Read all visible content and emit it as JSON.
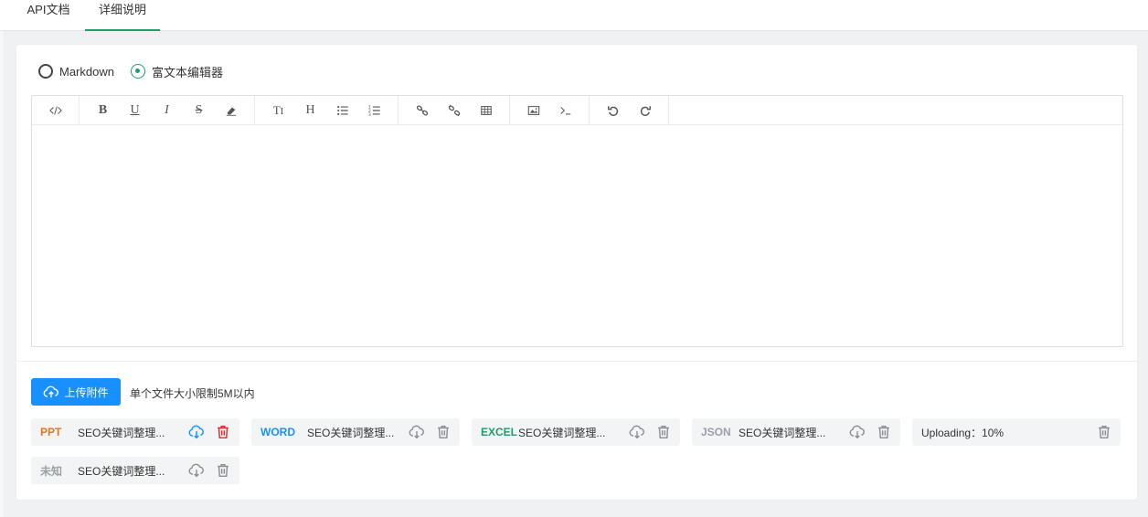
{
  "tabs": [
    {
      "label": "API文档",
      "active": false
    },
    {
      "label": "详细说明",
      "active": true
    }
  ],
  "editor_mode": {
    "options": [
      {
        "label": "Markdown",
        "checked": false
      },
      {
        "label": "富文本编辑器",
        "checked": true
      }
    ]
  },
  "toolbar": {
    "groups": [
      [
        "code-view-icon"
      ],
      [
        "bold-icon",
        "underline-icon",
        "italic-icon",
        "strikethrough-icon",
        "eraser-icon"
      ],
      [
        "font-size-icon",
        "heading-icon",
        "bullet-list-icon",
        "numbered-list-icon"
      ],
      [
        "link-icon",
        "unlink-icon",
        "table-icon"
      ],
      [
        "image-icon",
        "terminal-icon"
      ],
      [
        "undo-icon",
        "redo-icon"
      ]
    ]
  },
  "upload": {
    "button_label": "上传附件",
    "hint": "单个文件大小限制5M以内"
  },
  "files": [
    {
      "type": "PPT",
      "type_color": "#e8731a",
      "name": "SEO关键词整理...",
      "download_color": "#1890ff",
      "delete_color": "#e02b2b"
    },
    {
      "type": "WORD",
      "type_color": "#1890ff",
      "name": "SEO关键词整理...",
      "download_color": "#8a8f96",
      "delete_color": "#8a8f96"
    },
    {
      "type": "EXCEL",
      "type_color": "#1aa06d",
      "name": "SEO关键词整理...",
      "download_color": "#8a8f96",
      "delete_color": "#8a8f96"
    },
    {
      "type": "JSON",
      "type_color": "#9aa0a6",
      "name": "SEO关键词整理...",
      "download_color": "#8a8f96",
      "delete_color": "#8a8f96"
    },
    {
      "type": "",
      "type_color": "#333333",
      "name": "Uploading：10%",
      "download_color": "",
      "delete_color": "#8a8f96"
    },
    {
      "type": "未知",
      "type_color": "#9aa0a6",
      "name": "SEO关键词整理...",
      "download_color": "#8a8f96",
      "delete_color": "#8a8f96"
    }
  ],
  "accent_color": "#1aa06d"
}
